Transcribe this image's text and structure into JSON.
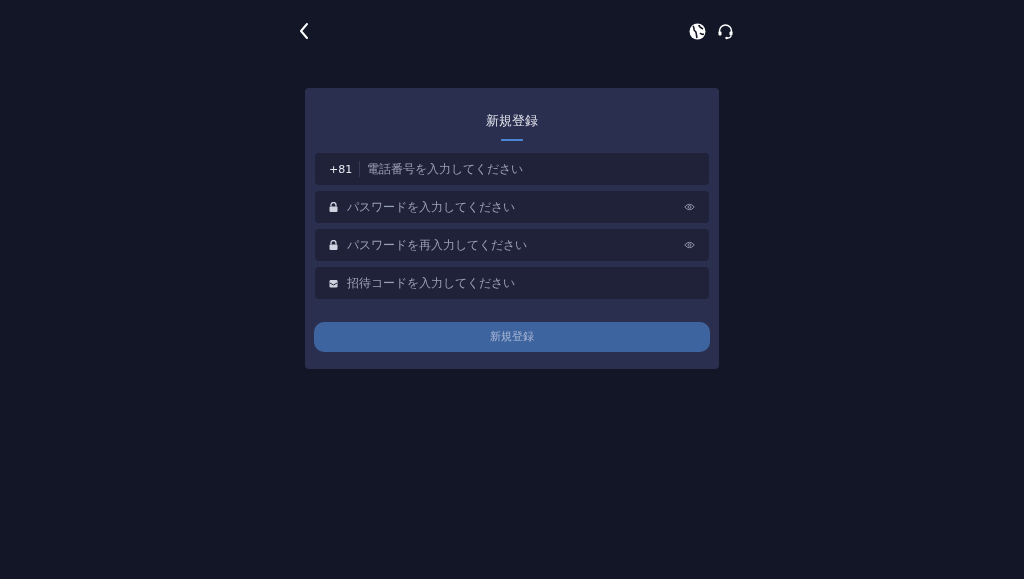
{
  "title": "新規登録",
  "fields": [
    {
      "kind": "phone",
      "prefix": "+81",
      "placeholder": "電話番号を入力してください"
    },
    {
      "kind": "password",
      "placeholder": "パスワードを入力してください"
    },
    {
      "kind": "password",
      "placeholder": "パスワードを再入力してください"
    },
    {
      "kind": "invite",
      "placeholder": "招待コードを入力してください"
    }
  ],
  "submit_button": {
    "label": "新規登録",
    "disabled": true
  }
}
